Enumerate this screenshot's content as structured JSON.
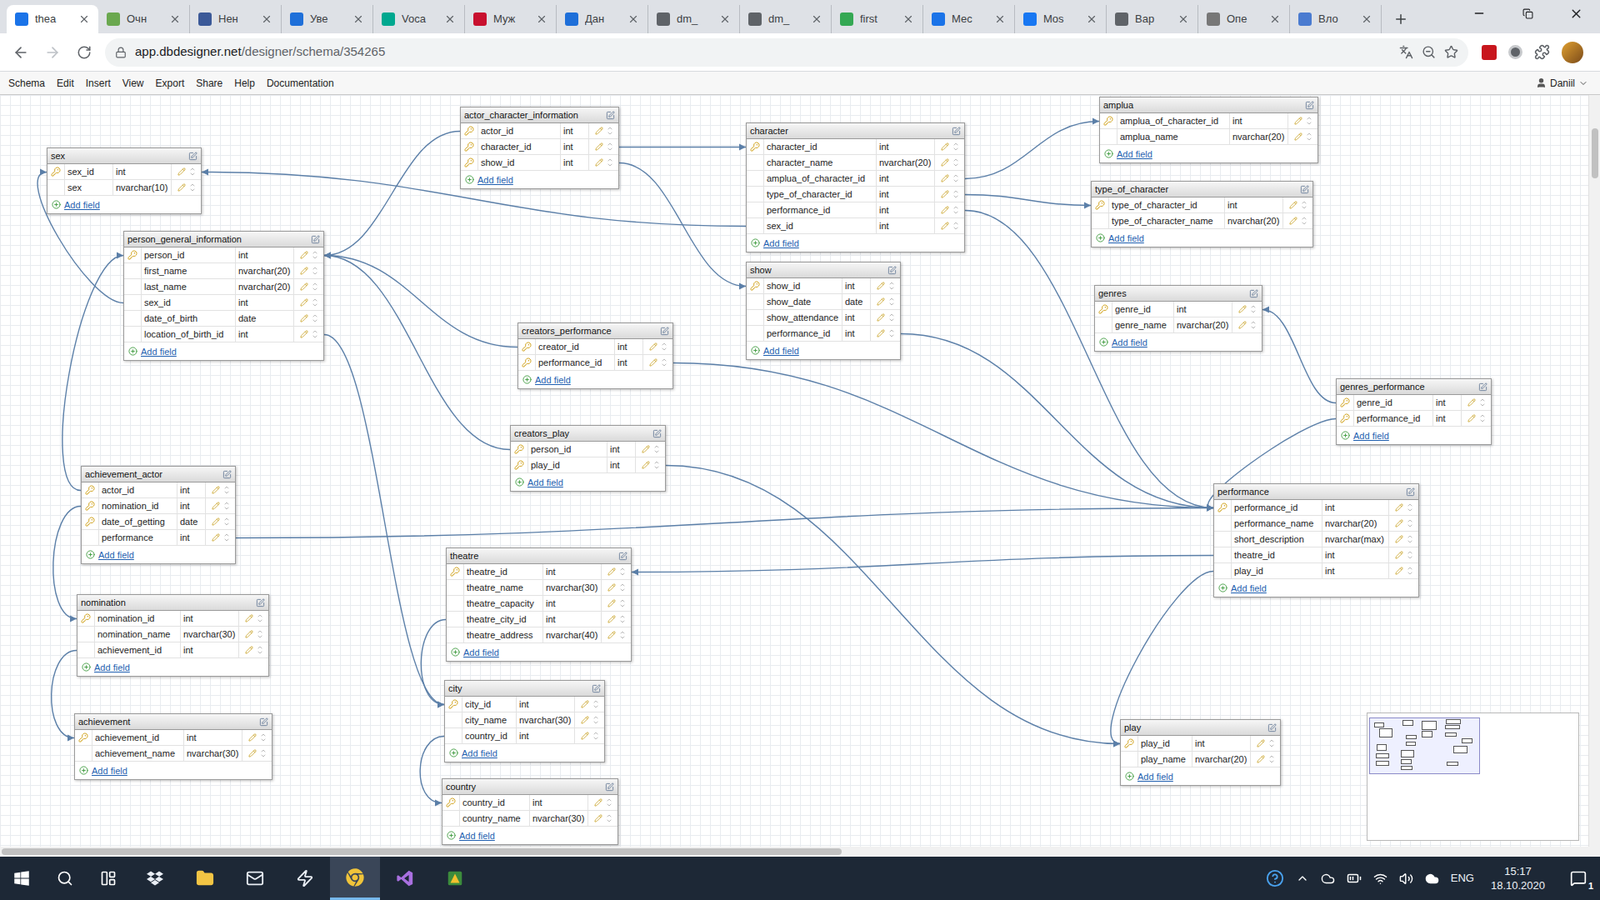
{
  "browser": {
    "tabs": [
      {
        "label": "thea",
        "selected": true,
        "color": "#1a73e8"
      },
      {
        "label": "Очн",
        "selected": false,
        "color": "#6aa84f"
      },
      {
        "label": "Нен",
        "selected": false,
        "color": "#3b5998"
      },
      {
        "label": "Уве",
        "selected": false,
        "color": "#1e6fd9"
      },
      {
        "label": "Voca",
        "selected": false,
        "color": "#00a88f"
      },
      {
        "label": "Муж",
        "selected": false,
        "color": "#c8102e"
      },
      {
        "label": "Дан",
        "selected": false,
        "color": "#1e6fd9"
      },
      {
        "label": "dm_",
        "selected": false,
        "color": "#5f6368"
      },
      {
        "label": "dm_",
        "selected": false,
        "color": "#5f6368"
      },
      {
        "label": "first",
        "selected": false,
        "color": "#34a853"
      },
      {
        "label": "Мес",
        "selected": false,
        "color": "#1a73e8"
      },
      {
        "label": "Mos",
        "selected": false,
        "color": "#1877f2"
      },
      {
        "label": "Вар",
        "selected": false,
        "color": "#5f6368"
      },
      {
        "label": "Опе",
        "selected": false,
        "color": "#777777"
      },
      {
        "label": "Вло",
        "selected": false,
        "color": "#4a7bd0"
      }
    ],
    "url_host": "app.dbdesigner.net",
    "url_path": "/designer/schema/354265"
  },
  "menu": [
    "Schema",
    "Edit",
    "Insert",
    "View",
    "Export",
    "Share",
    "Help",
    "Documentation"
  ],
  "user": "Daniil",
  "add_field_label": "Add field",
  "tables": [
    {
      "name": "sex",
      "fields": [
        {
          "name": "sex_id",
          "type": "int",
          "primary_key": true
        },
        {
          "name": "sex",
          "type": "nvarchar(10)",
          "primary_key": false
        }
      ]
    },
    {
      "name": "person_general_information",
      "fields": [
        {
          "name": "person_id",
          "type": "int",
          "primary_key": true
        },
        {
          "name": "first_name",
          "type": "nvarchar(20)",
          "primary_key": false
        },
        {
          "name": "last_name",
          "type": "nvarchar(20)",
          "primary_key": false
        },
        {
          "name": "sex_id",
          "type": "int",
          "primary_key": false
        },
        {
          "name": "date_of_birth",
          "type": "date",
          "primary_key": false
        },
        {
          "name": "location_of_birth_id",
          "type": "int",
          "primary_key": false
        }
      ]
    },
    {
      "name": "actor_character_information",
      "fields": [
        {
          "name": "actor_id",
          "type": "int",
          "primary_key": true
        },
        {
          "name": "character_id",
          "type": "int",
          "primary_key": true
        },
        {
          "name": "show_id",
          "type": "int",
          "primary_key": true
        }
      ]
    },
    {
      "name": "character",
      "fields": [
        {
          "name": "character_id",
          "type": "int",
          "primary_key": true
        },
        {
          "name": "character_name",
          "type": "nvarchar(20)",
          "primary_key": false
        },
        {
          "name": "amplua_of_character_id",
          "type": "int",
          "primary_key": false
        },
        {
          "name": "type_of_character_id",
          "type": "int",
          "primary_key": false
        },
        {
          "name": "performance_id",
          "type": "int",
          "primary_key": false
        },
        {
          "name": "sex_id",
          "type": "int",
          "primary_key": false
        }
      ]
    },
    {
      "name": "amplua",
      "fields": [
        {
          "name": "amplua_of_character_id",
          "type": "int",
          "primary_key": true
        },
        {
          "name": "amplua_name",
          "type": "nvarchar(20)",
          "primary_key": false
        }
      ]
    },
    {
      "name": "type_of_character",
      "fields": [
        {
          "name": "type_of_character_id",
          "type": "int",
          "primary_key": true
        },
        {
          "name": "type_of_character_name",
          "type": "nvarchar(20)",
          "primary_key": false
        }
      ]
    },
    {
      "name": "show",
      "fields": [
        {
          "name": "show_id",
          "type": "int",
          "primary_key": true
        },
        {
          "name": "show_date",
          "type": "date",
          "primary_key": false
        },
        {
          "name": "show_attendance",
          "type": "int",
          "primary_key": false
        },
        {
          "name": "performance_id",
          "type": "int",
          "primary_key": false
        }
      ]
    },
    {
      "name": "genres",
      "fields": [
        {
          "name": "genre_id",
          "type": "int",
          "primary_key": true
        },
        {
          "name": "genre_name",
          "type": "nvarchar(20)",
          "primary_key": false
        }
      ]
    },
    {
      "name": "genres_performance",
      "fields": [
        {
          "name": "genre_id",
          "type": "int",
          "primary_key": true
        },
        {
          "name": "performance_id",
          "type": "int",
          "primary_key": true
        }
      ]
    },
    {
      "name": "creators_performance",
      "fields": [
        {
          "name": "creator_id",
          "type": "int",
          "primary_key": true
        },
        {
          "name": "performance_id",
          "type": "int",
          "primary_key": true
        }
      ]
    },
    {
      "name": "creators_play",
      "fields": [
        {
          "name": "person_id",
          "type": "int",
          "primary_key": true
        },
        {
          "name": "play_id",
          "type": "int",
          "primary_key": true
        }
      ]
    },
    {
      "name": "performance",
      "fields": [
        {
          "name": "performance_id",
          "type": "int",
          "primary_key": true
        },
        {
          "name": "performance_name",
          "type": "nvarchar(20)",
          "primary_key": false
        },
        {
          "name": "short_description",
          "type": "nvarchar(max)",
          "primary_key": false
        },
        {
          "name": "theatre_id",
          "type": "int",
          "primary_key": false
        },
        {
          "name": "play_id",
          "type": "int",
          "primary_key": false
        }
      ]
    },
    {
      "name": "achievement_actor",
      "fields": [
        {
          "name": "actor_id",
          "type": "int",
          "primary_key": true
        },
        {
          "name": "nomination_id",
          "type": "int",
          "primary_key": true
        },
        {
          "name": "date_of_getting",
          "type": "date",
          "primary_key": true
        },
        {
          "name": "performance",
          "type": "int",
          "primary_key": false
        }
      ]
    },
    {
      "name": "theatre",
      "fields": [
        {
          "name": "theatre_id",
          "type": "int",
          "primary_key": true
        },
        {
          "name": "theatre_name",
          "type": "nvarchar(30)",
          "primary_key": false
        },
        {
          "name": "theatre_capacity",
          "type": "int",
          "primary_key": false
        },
        {
          "name": "theatre_city_id",
          "type": "int",
          "primary_key": false
        },
        {
          "name": "theatre_address",
          "type": "nvarchar(40)",
          "primary_key": false
        }
      ]
    },
    {
      "name": "nomination",
      "fields": [
        {
          "name": "nomination_id",
          "type": "int",
          "primary_key": true
        },
        {
          "name": "nomination_name",
          "type": "nvarchar(30)",
          "primary_key": false
        },
        {
          "name": "achievement_id",
          "type": "int",
          "primary_key": false
        }
      ]
    },
    {
      "name": "city",
      "fields": [
        {
          "name": "city_id",
          "type": "int",
          "primary_key": true
        },
        {
          "name": "city_name",
          "type": "nvarchar(30)",
          "primary_key": false
        },
        {
          "name": "country_id",
          "type": "int",
          "primary_key": false
        }
      ]
    },
    {
      "name": "achievement",
      "fields": [
        {
          "name": "achievement_id",
          "type": "int",
          "primary_key": true
        },
        {
          "name": "achievement_name",
          "type": "nvarchar(30)",
          "primary_key": false
        }
      ]
    },
    {
      "name": "play",
      "fields": [
        {
          "name": "play_id",
          "type": "int",
          "primary_key": true
        },
        {
          "name": "play_name",
          "type": "nvarchar(20)",
          "primary_key": false
        }
      ]
    },
    {
      "name": "country",
      "fields": [
        {
          "name": "country_id",
          "type": "int",
          "primary_key": true
        },
        {
          "name": "country_name",
          "type": "nvarchar(30)",
          "primary_key": false
        }
      ]
    }
  ],
  "relations": [
    {
      "from": [
        "actor_character_information",
        "character_id"
      ],
      "to": [
        "character",
        "character_id"
      ]
    },
    {
      "from": [
        "actor_character_information",
        "show_id"
      ],
      "to": [
        "show",
        "show_id"
      ]
    },
    {
      "from": [
        "actor_character_information",
        "actor_id"
      ],
      "to": [
        "person_general_information",
        "person_id"
      ]
    },
    {
      "from": [
        "character",
        "sex_id"
      ],
      "to": [
        "sex",
        "sex_id"
      ]
    },
    {
      "from": [
        "character",
        "amplua_of_character_id"
      ],
      "to": [
        "amplua",
        "amplua_of_character_id"
      ]
    },
    {
      "from": [
        "character",
        "type_of_character_id"
      ],
      "to": [
        "type_of_character",
        "type_of_character_id"
      ]
    },
    {
      "from": [
        "character",
        "performance_id"
      ],
      "to": [
        "performance",
        "performance_id"
      ]
    },
    {
      "from": [
        "show",
        "performance_id"
      ],
      "to": [
        "performance",
        "performance_id"
      ]
    },
    {
      "from": [
        "person_general_information",
        "sex_id"
      ],
      "to": [
        "sex",
        "sex_id"
      ]
    },
    {
      "from": [
        "creators_performance",
        "creator_id"
      ],
      "to": [
        "person_general_information",
        "person_id"
      ]
    },
    {
      "from": [
        "creators_performance",
        "performance_id"
      ],
      "to": [
        "performance",
        "performance_id"
      ]
    },
    {
      "from": [
        "creators_play",
        "person_id"
      ],
      "to": [
        "person_general_information",
        "person_id"
      ]
    },
    {
      "from": [
        "creators_play",
        "play_id"
      ],
      "to": [
        "play",
        "play_id"
      ]
    },
    {
      "from": [
        "genres_performance",
        "genre_id"
      ],
      "to": [
        "genres",
        "genre_id"
      ]
    },
    {
      "from": [
        "genres_performance",
        "performance_id"
      ],
      "to": [
        "performance",
        "performance_id"
      ]
    },
    {
      "from": [
        "achievement_actor",
        "actor_id"
      ],
      "to": [
        "person_general_information",
        "person_id"
      ]
    },
    {
      "from": [
        "achievement_actor",
        "performance"
      ],
      "to": [
        "performance",
        "performance_id"
      ]
    },
    {
      "from": [
        "achievement_actor",
        "nomination_id"
      ],
      "to": [
        "nomination",
        "nomination_id"
      ]
    },
    {
      "from": [
        "nomination",
        "achievement_id"
      ],
      "to": [
        "achievement",
        "achievement_id"
      ]
    },
    {
      "from": [
        "performance",
        "theatre_id"
      ],
      "to": [
        "theatre",
        "theatre_id"
      ]
    },
    {
      "from": [
        "performance",
        "play_id"
      ],
      "to": [
        "play",
        "play_id"
      ]
    },
    {
      "from": [
        "person_general_information",
        "location_of_birth_id"
      ],
      "to": [
        "city",
        "city_id"
      ]
    },
    {
      "from": [
        "theatre",
        "theatre_city_id"
      ],
      "to": [
        "city",
        "city_id"
      ]
    },
    {
      "from": [
        "city",
        "country_id"
      ],
      "to": [
        "country",
        "country_id"
      ]
    }
  ],
  "taskbar": {
    "apps": [
      {
        "selected": false
      },
      {
        "selected": false
      },
      {
        "selected": false
      },
      {
        "selected": false
      },
      {
        "selected": true
      },
      {
        "selected": false
      },
      {
        "selected": false
      }
    ],
    "language": "ENG",
    "time": "15:17",
    "date": "18.10.2020",
    "notifications": "1"
  }
}
